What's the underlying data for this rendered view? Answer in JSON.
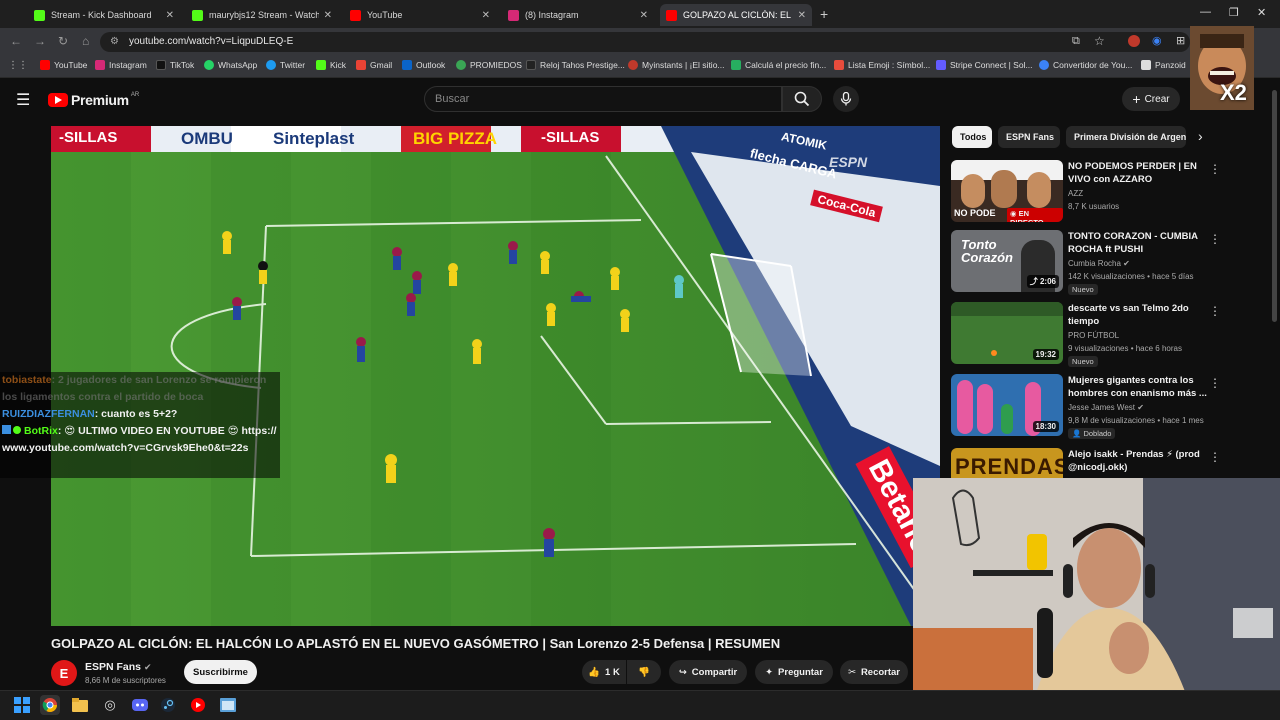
{
  "browser": {
    "tabs": [
      {
        "label": "Stream - Kick Dashboard",
        "color": "#53fc18"
      },
      {
        "label": "maurybjs12 Stream - Watch Live",
        "color": "#53fc18"
      },
      {
        "label": "YouTube",
        "color": "#ff0000"
      },
      {
        "label": "(8) Instagram",
        "color": "#d62976"
      },
      {
        "label": "GOLPAZO AL CICLÓN: EL H",
        "color": "#ff0000"
      }
    ],
    "url": "youtube.com/watch?v=LiqpuDLEQ-E",
    "bookmarks": [
      {
        "label": "YouTube",
        "color": "#ff0000"
      },
      {
        "label": "Instagram",
        "color": "#d62976"
      },
      {
        "label": "TikTok",
        "color": "#111111"
      },
      {
        "label": "WhatsApp",
        "color": "#25d366"
      },
      {
        "label": "Twitter",
        "color": "#1d9bf0"
      },
      {
        "label": "Kick",
        "color": "#53fc18"
      },
      {
        "label": "Gmail",
        "color": "#ea4335"
      },
      {
        "label": "Outlook",
        "color": "#0a64c8"
      },
      {
        "label": "PROMIEDOS",
        "color": "#3aa655"
      },
      {
        "label": "Reloj Tahos Prestige...",
        "color": "#222222"
      },
      {
        "label": "Myinstants | ¡El sitio...",
        "color": "#c0392b"
      },
      {
        "label": "Calculá el precio fin...",
        "color": "#27ae60"
      },
      {
        "label": "Lista Emoji : Símbol...",
        "color": "#e74c3c"
      },
      {
        "label": "Stripe Connect | Sol...",
        "color": "#635bff"
      },
      {
        "label": "Convertidor de You...",
        "color": "#3b82f6"
      },
      {
        "label": "Panzoid",
        "color": "#dddddd"
      }
    ]
  },
  "youtube": {
    "logo_text": "Premium",
    "country": "AR",
    "search_placeholder": "Buscar",
    "create_label": "Crear"
  },
  "video": {
    "title": "GOLPAZO AL CICLÓN: EL HALCÓN LO APLASTÓ EN EL NUEVO GASÓMETRO | San Lorenzo 2-5 Defensa | RESUMEN",
    "ads_top": [
      "-SILLAS",
      "OMBU",
      "Sinteplast",
      "BIG PIZZA",
      "-SILLAS",
      "ATOMIK"
    ],
    "ads_side": [
      "flecha CARGA",
      "Coca-Cola",
      "ESPN",
      "Betano"
    ],
    "channel_name": "ESPN Fans",
    "subscribers": "8,66 M de suscriptores",
    "subscribe_label": "Suscribirme",
    "likes": "1 K",
    "share_label": "Compartir",
    "ask_label": "Preguntar",
    "clip_label": "Recortar"
  },
  "chat": [
    {
      "user": "tobiastate",
      "user_color": "#e67e22",
      "text": ": 2 jugadores de san Lorenzo se rompieron los ligamentos contra el partido de boca"
    },
    {
      "user": "RUIZDIAZFERNAN",
      "user_color": "#3b8fe0",
      "text": ": cuanto es 5+2?"
    },
    {
      "user": "BotRix",
      "user_color": "#53fc18",
      "text": ": 😍 ULTIMO VIDEO EN YOUTUBE 😍 https://www.youtube.com/watch?v=CGrvsk9Ehe0&t=22s"
    }
  ],
  "chips": [
    "Todos",
    "ESPN Fans",
    "Primera División de Argen"
  ],
  "recommendations": [
    {
      "title": "NO PODEMOS PERDER | EN VIVO con AZZARO",
      "channel": "AZZ",
      "meta": "8,7 K usuarios",
      "badge": "EN DIRECTO",
      "duration": "",
      "thumb": "#3a2a22"
    },
    {
      "title": "TONTO CORAZON - CUMBIA ROCHA ft PUSHI",
      "channel": "Cumbia Rocha",
      "meta": "142 K visualizaciones • hace 5 días",
      "badge": "Nuevo",
      "duration": "2:06",
      "thumb": "#6d6f73"
    },
    {
      "title": "descarte vs san Telmo 2do tiempo",
      "channel": "PRO FÚTBOL",
      "meta": "9 visualizaciones • hace 6 horas",
      "badge": "Nuevo",
      "duration": "19:32",
      "thumb": "#3f7a32"
    },
    {
      "title": "Mujeres gigantes contra los hombres con enanismo más ...",
      "channel": "Jesse James West",
      "meta": "9,8 M de visualizaciones • hace 1 mes",
      "badge": "Doblado",
      "duration": "18:30",
      "thumb": "#2f6fb0"
    },
    {
      "title": "Alejo isakk - Prendas ⚡ (prod @nicodj.okk)",
      "channel": "",
      "meta": "",
      "badge": "",
      "duration": "",
      "thumb": "#c8961e"
    }
  ],
  "thumb_texts": {
    "azz": "NO PODE",
    "tonto": "Tonto Corazón",
    "prendas": "PRENDAS"
  },
  "overlay_badge": "X2"
}
